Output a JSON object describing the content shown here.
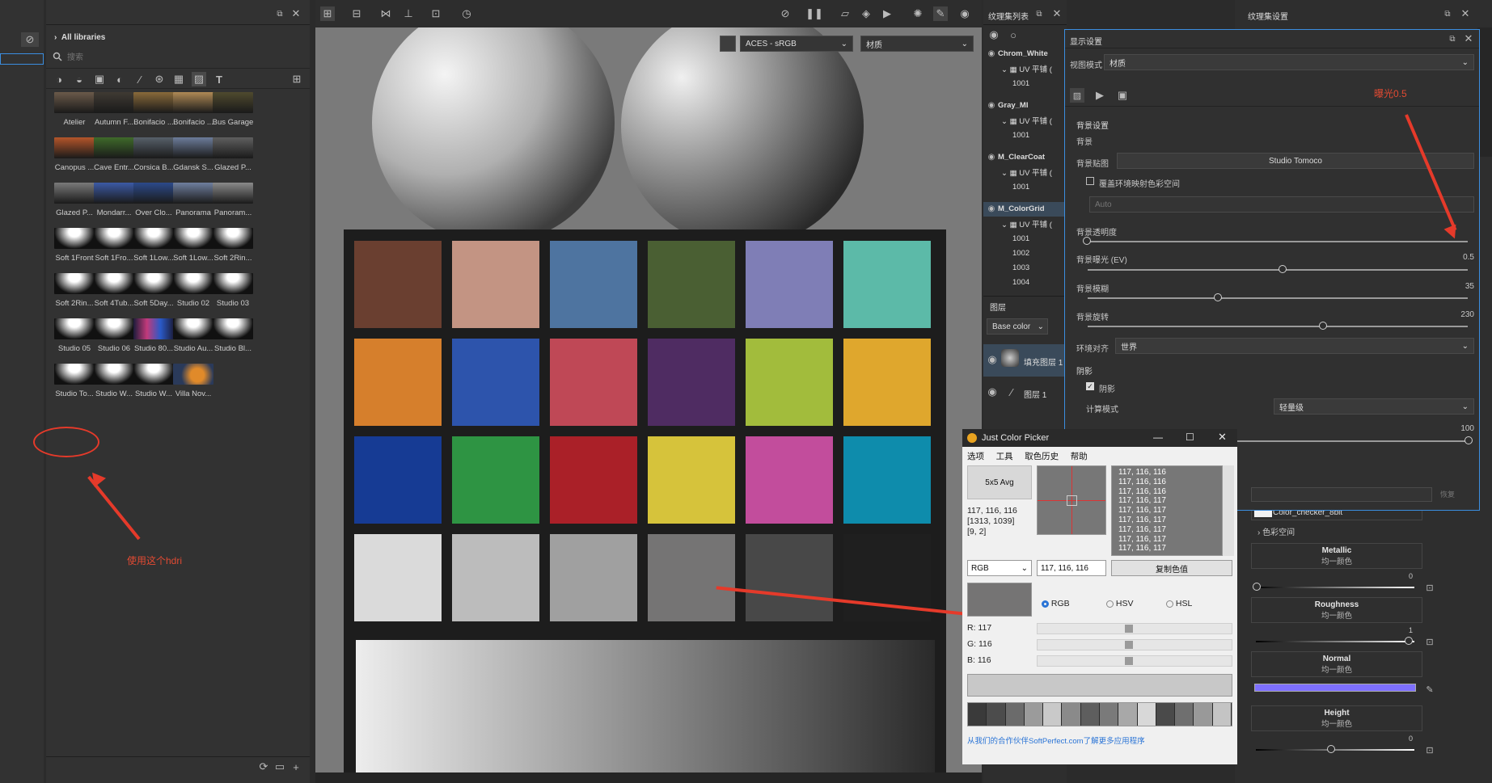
{
  "left_panel": {
    "breadcrumb": "All libraries",
    "search_placeholder": "搜索",
    "hdri_items": [
      {
        "label": "Atelier"
      },
      {
        "label": "Autumn F..."
      },
      {
        "label": "Bonifacio ..."
      },
      {
        "label": "Bonifacio ..."
      },
      {
        "label": "Bus Garage"
      },
      {
        "label": "Canopus ..."
      },
      {
        "label": "Cave Entr..."
      },
      {
        "label": "Corsica B..."
      },
      {
        "label": "Gdansk S..."
      },
      {
        "label": "Glazed P..."
      },
      {
        "label": "Glazed P..."
      },
      {
        "label": "Mondarr..."
      },
      {
        "label": "Over Clo..."
      },
      {
        "label": "Panorama"
      },
      {
        "label": "Panoram..."
      },
      {
        "label": "Soft 1Front"
      },
      {
        "label": "Soft 1Fro..."
      },
      {
        "label": "Soft 1Low..."
      },
      {
        "label": "Soft 1Low..."
      },
      {
        "label": "Soft 2Rin..."
      },
      {
        "label": "Soft 2Rin..."
      },
      {
        "label": "Soft 4Tub..."
      },
      {
        "label": "Soft 5Day..."
      },
      {
        "label": "Studio 02"
      },
      {
        "label": "Studio 03"
      },
      {
        "label": "Studio 05"
      },
      {
        "label": "Studio 06"
      },
      {
        "label": "Studio 80..."
      },
      {
        "label": "Studio Au..."
      },
      {
        "label": "Studio Bl..."
      },
      {
        "label": "Studio To..."
      },
      {
        "label": "Studio W..."
      },
      {
        "label": "Studio W..."
      },
      {
        "label": "Villa Nov..."
      }
    ],
    "annotation": "使用这个hdri"
  },
  "viewport": {
    "colorspace": "ACES - sRGB",
    "mode": "材质",
    "swatches": [
      "#6a3f30",
      "#c39483",
      "#4e74a0",
      "#4a5f33",
      "#7f7eb6",
      "#5cbaa8",
      "#d67f2c",
      "#2d54ac",
      "#bf4856",
      "#4f2c62",
      "#a2bc3c",
      "#dfa72d",
      "#163b94",
      "#2e9443",
      "#aa2028",
      "#d6c33b",
      "#c24d9c",
      "#0e8cac",
      "#dadada",
      "#bcbcbc",
      "#a0a0a0",
      "#757474",
      "#484848",
      "#1f1f1f"
    ]
  },
  "texture_list": {
    "title": "纹理集列表",
    "sets": [
      {
        "name": "Chrom_White",
        "uv": "UV 平铺 (",
        "tile": "1001"
      },
      {
        "name": "Gray_MI",
        "uv": "UV 平铺 (",
        "tile": "1001"
      },
      {
        "name": "M_ClearCoat",
        "uv": "UV 平铺 (",
        "tile": "1001"
      },
      {
        "name": "M_ColorGrid",
        "uv": "UV 平铺 (",
        "tiles": [
          "1001",
          "1002",
          "1003",
          "1004"
        ]
      }
    ],
    "layers_title": "图层",
    "channel": "Base color",
    "layers": [
      "填充图层 1",
      "图层 1"
    ]
  },
  "display_settings": {
    "title": "显示设置",
    "view_mode_label": "视图模式",
    "view_mode_value": "材质",
    "annotation": "曝光0.5",
    "bg_section": "背景设置",
    "bg_label": "背景",
    "bg_map_label": "背景贴图",
    "bg_map_value": "Studio Tomoco",
    "override_label": "覆盖环境映射色彩空间",
    "auto": "Auto",
    "opacity_label": "背景透明度",
    "exposure_label": "背景曝光 (EV)",
    "exposure_value": "0.5",
    "blur_label": "背景模糊",
    "blur_value": "35",
    "rotation_label": "背景旋转",
    "rotation_value": "230",
    "env_align_label": "环境对齐",
    "env_align_value": "世界",
    "shadow_section": "阴影",
    "shadow_label": "阴影",
    "calc_mode_label": "计算模式",
    "calc_mode_value": "轻量级",
    "slider_value": "100",
    "reset": "恢复"
  },
  "tex_settings": {
    "title": "纹理集设置",
    "texture_name": "Color_checker_8bit",
    "colorspace": "色彩空间",
    "channels": [
      {
        "name": "Metallic",
        "sub": "均一颜色",
        "value": "0"
      },
      {
        "name": "Roughness",
        "sub": "均一颜色",
        "value": "1"
      },
      {
        "name": "Normal",
        "sub": "均一颜色"
      },
      {
        "name": "Height",
        "sub": "均一颜色",
        "value": "0"
      }
    ]
  },
  "color_picker": {
    "title": "Just Color Picker",
    "menu": [
      "选项",
      "工具",
      "取色历史",
      "帮助"
    ],
    "avg_button": "5x5 Avg",
    "value": "117, 116, 116",
    "coords": "[1313, 1039]",
    "offset": "[9, 2]",
    "history": [
      "117, 116, 116",
      "117, 116, 116",
      "117, 116, 116",
      "117, 116, 117",
      "117, 116, 117",
      "117, 116, 117",
      "117, 116, 117",
      "117, 116, 117",
      "117, 116, 117"
    ],
    "format": "RGB",
    "value_field": "117, 116, 116",
    "copy_button": "复制色值",
    "modes": [
      "RGB",
      "HSV",
      "HSL"
    ],
    "r": "R: 117",
    "g": "G: 116",
    "b": "B: 116",
    "footer": "从我们的合作伙伴SoftPerfect.com了解更多应用程序",
    "palette": [
      "#3a3a3a",
      "#4c4c4c",
      "#6b6b6b",
      "#9b9b9b",
      "#c9c9c9",
      "#8a8a8a",
      "#5e5e5e",
      "#7a7a7a",
      "#a8a8a8",
      "#d8d8d8",
      "#4a4a4a",
      "#6f6f6f",
      "#999999",
      "#c4c4c4"
    ],
    "swatch_color": "#757474"
  }
}
